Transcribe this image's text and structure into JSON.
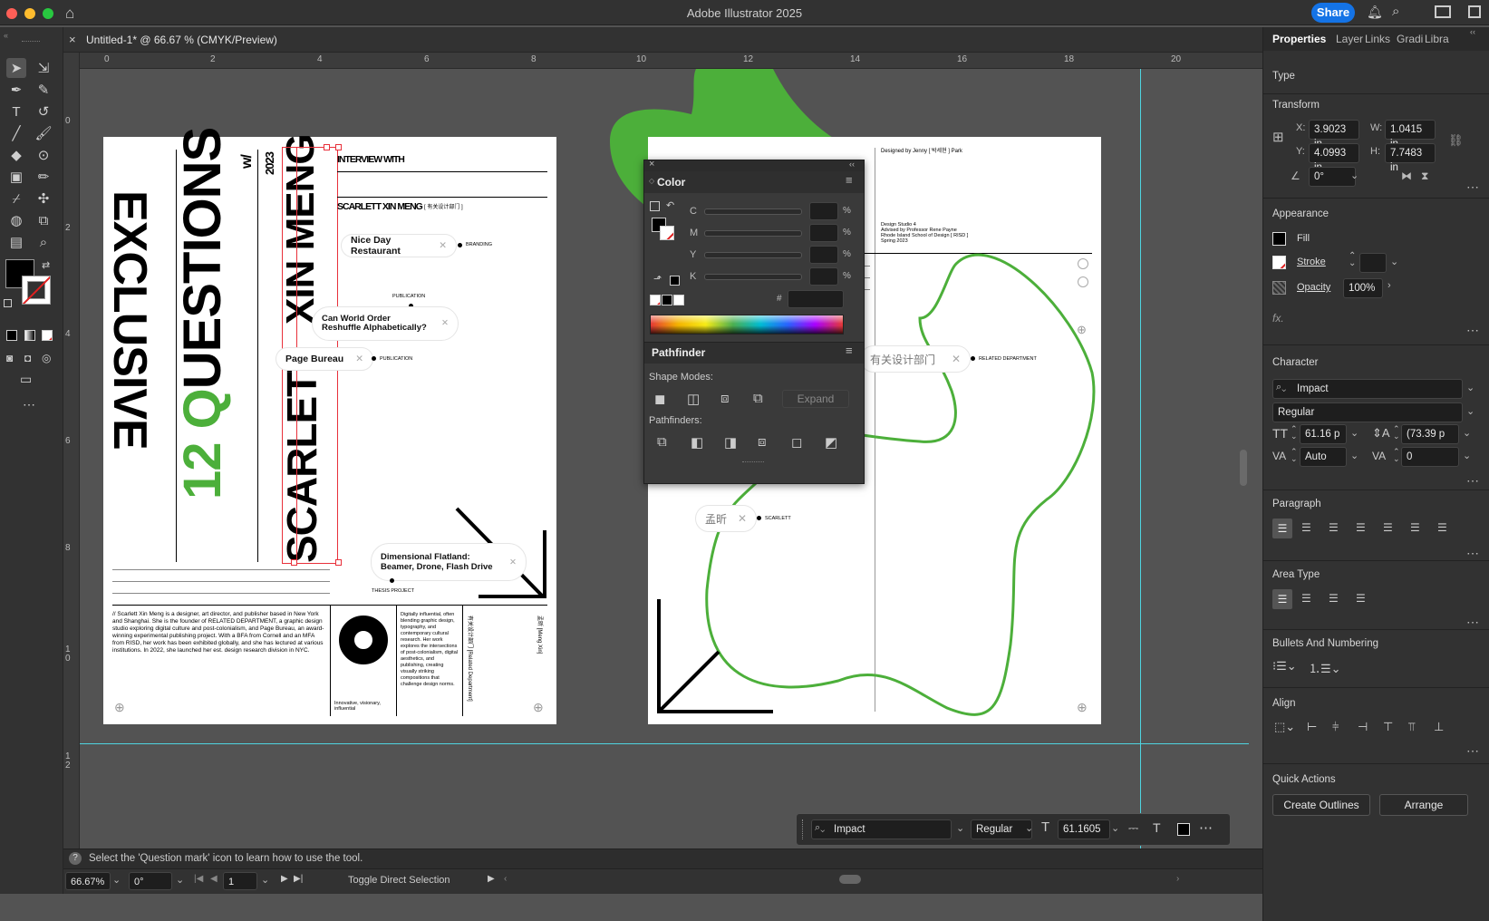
{
  "app": {
    "title": "Adobe Illustrator 2025",
    "share_label": "Share"
  },
  "document": {
    "tab_title": "Untitled-1* @ 66.67 % (CMYK/Preview)"
  },
  "ruler": {
    "h_ticks": [
      "0",
      "2",
      "4",
      "6",
      "8",
      "10",
      "12",
      "14",
      "16",
      "18",
      "20"
    ],
    "v_ticks": [
      "0",
      "2",
      "4",
      "6",
      "8",
      "1\n0",
      "1\n2"
    ]
  },
  "panel_tabs": [
    "Properties",
    "Layer",
    "Links",
    "Gradi",
    "Libra"
  ],
  "properties": {
    "type_label": "Type",
    "transform": {
      "heading": "Transform",
      "x_label": "X:",
      "x": "3.9023 in",
      "y_label": "Y:",
      "y": "4.0993 in",
      "w_label": "W:",
      "w": "1.0415 in",
      "h_label": "H:",
      "h": "7.7483 in",
      "angle": "0°"
    },
    "appearance": {
      "heading": "Appearance",
      "fill_label": "Fill",
      "stroke_label": "Stroke",
      "opacity_label": "Opacity",
      "opacity": "100%"
    },
    "character": {
      "heading": "Character",
      "font": "Impact",
      "style": "Regular",
      "size": "61.16 p",
      "leading": "(73.39 p",
      "kerning": "Auto",
      "tracking": "0"
    },
    "paragraph_heading": "Paragraph",
    "area_type_heading": "Area Type",
    "bullets_heading": "Bullets And Numbering",
    "align_heading": "Align",
    "quick_actions": {
      "heading": "Quick Actions",
      "create_outlines": "Create Outlines",
      "arrange": "Arrange"
    }
  },
  "color_panel": {
    "title": "Color",
    "labels": [
      "C",
      "M",
      "Y",
      "K"
    ],
    "percent": "%",
    "hash": "#"
  },
  "pathfinder": {
    "title": "Pathfinder",
    "shape_modes": "Shape Modes:",
    "expand": "Expand",
    "pathfinders": "Pathfinders:"
  },
  "context_bar": {
    "font": "Impact",
    "style": "Regular",
    "size": "61.1605"
  },
  "status": {
    "hint": "Select the 'Question mark' icon to learn how to use the tool.",
    "zoom": "66.67%",
    "rotation": "0°",
    "artboard": "1",
    "tool": "Toggle Direct Selection"
  },
  "artboard1": {
    "exclusive": "EXCLUSIVE",
    "questions_num": "12",
    "questions_q": "Q",
    "questions_rest": "UESTIONS",
    "w_slash": "w/",
    "year": "2023",
    "xin_meng": "XIN MENG",
    "scarlett": "SCARLETT",
    "interview_with": "INTERVIEW WITH",
    "scarlett_xin_meng": "SCARLETT XIN MENG",
    "cn_small": "[ 有关设计部门 ]",
    "pill1": "Nice Day Restaurant",
    "pill1_tag": "BRANDING",
    "publication_top": "PUBLICATION",
    "pill2_line1": "Can World Order",
    "pill2_line2": "Reshuffle Alphabetically?",
    "pill3": "Page Bureau",
    "pill3_tag": "PUBLICATION",
    "pill4_line1": "Dimensional Flatland:",
    "pill4_line2": "Beamer, Drone, Flash Drive",
    "thesis": "THESIS PROJECT",
    "bio": "// Scarlett Xin Meng is a designer, art director, and publisher based in New York and Shanghai. She is the founder of RELATED DEPARTMENT, a graphic design studio exploring digital culture and post-colonialism, and Page Bureau, an award-winning experimental publishing project. With a BFA from Cornell and an MFA from RISD, her work has been exhibited globally, and she has lectured at various institutions. In 2022, she launched her est. design research division in NYC.",
    "col2": "Digitally influential, often blending graphic design, typography, and contemporary cultural research. Her work explores the intersections of post-colonialism, digital aesthetics, and publishing, creating visually striking compositions that challenge design norms.",
    "innovative": "Innovative, visionary, influential",
    "vert1": "有关设计部门 [Related Department]",
    "vert2": "孟昕 [Meng Xin]"
  },
  "artboard2": {
    "designed_by": "Designed by Jenny [ 박세현 ] Park",
    "studio1": "Design Studio 4",
    "studio2": "Advised by Professor Rene Payne",
    "studio3": "Rhode Island School of Design [ RISD ]",
    "studio4": "Spring 2023",
    "pill_cn": "有关设计部门",
    "pill_cn_tag": "RELATED DEPARTMENT",
    "pill_name": "孟昕",
    "pill_name_tag": "SCARLETT"
  }
}
